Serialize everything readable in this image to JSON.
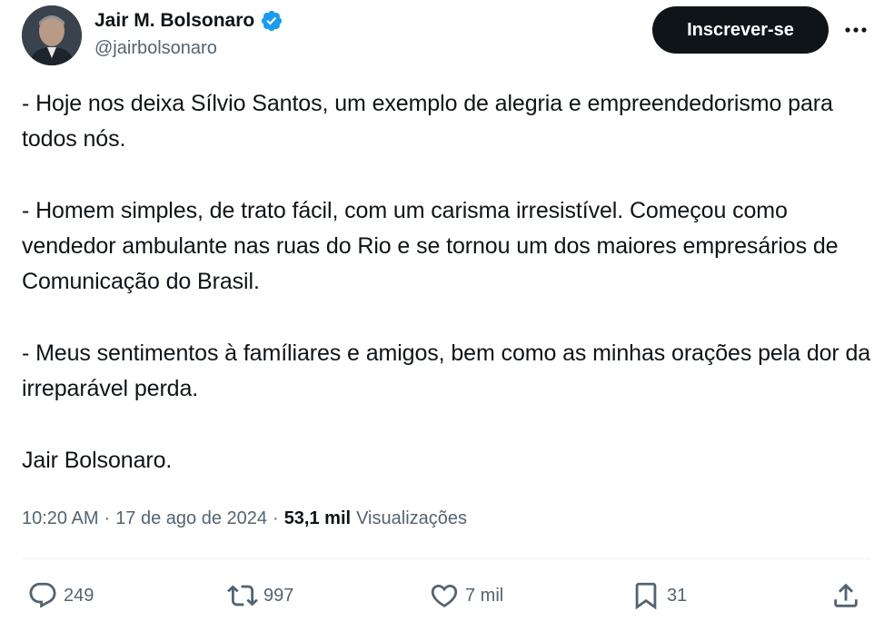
{
  "author": {
    "name": "Jair M. Bolsonaro",
    "handle": "@jairbolsonaro",
    "verified_color": "#1d9bf0"
  },
  "subscribe_label": "Inscrever-se",
  "more_icon": "more-horizontal-icon",
  "tweet": {
    "paragraphs": [
      "- Hoje nos deixa Sílvio Santos, um exemplo de alegria e empreendedorismo para todos nós.",
      "- Homem simples, de trato fácil, com um carisma irresistível. Começou como vendedor ambulante nas ruas do Rio e se tornou um dos maiores empresários de Comunicação do Brasil.",
      "- Meus sentimentos à famíliares e amigos, bem como as minhas orações pela dor da irreparável perda.",
      "Jair Bolsonaro."
    ]
  },
  "meta": {
    "time": "10:20 AM",
    "separator": "·",
    "date": "17 de ago de 2024",
    "views_count": "53,1 mil",
    "views_label": "Visualizações"
  },
  "actions": {
    "replies": "249",
    "reposts": "997",
    "likes": "7 mil",
    "bookmarks": "31"
  },
  "colors": {
    "text_primary": "#0f1419",
    "text_secondary": "#536471",
    "button_bg": "#0f1419",
    "divider": "#eff3f4"
  }
}
